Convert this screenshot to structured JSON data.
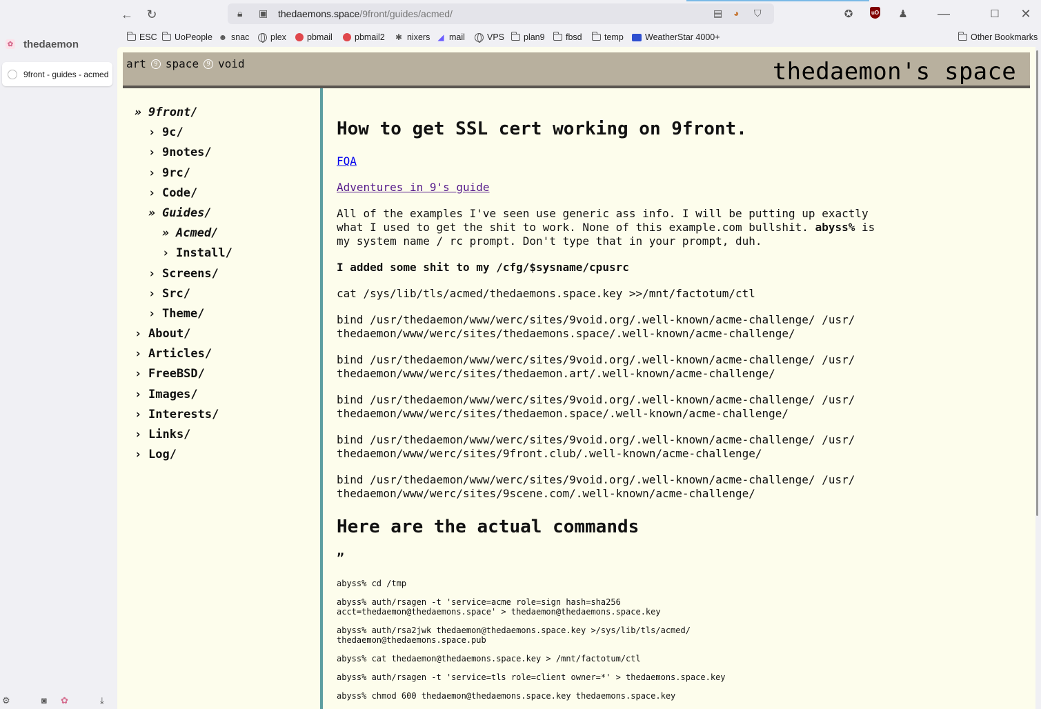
{
  "browser": {
    "profile_name": "thedaemon",
    "tab_title": "9front - guides - acmed",
    "url_host": "thedaemons.space",
    "url_path": "/9front/guides/acmed/",
    "bookmarks": [
      "ESC",
      "UoPeople",
      "snac",
      "plex",
      "pbmail",
      "pbmail2",
      "nixers",
      "mail",
      "VPS",
      "plan9",
      "fbsd",
      "temp",
      "WeatherStar 4000+"
    ],
    "other_bookmarks": "Other Bookmarks"
  },
  "site": {
    "title": "thedaemon's space",
    "topnav": [
      "art",
      "space",
      "void"
    ]
  },
  "nav": [
    {
      "label": "9front/",
      "open": true
    },
    {
      "label": "9c/"
    },
    {
      "label": "9notes/"
    },
    {
      "label": "9rc/"
    },
    {
      "label": "Code/"
    },
    {
      "label": "Guides/",
      "open": true
    },
    {
      "label": "Acmed/",
      "open": true
    },
    {
      "label": "Install/"
    },
    {
      "label": "Screens/"
    },
    {
      "label": "Src/"
    },
    {
      "label": "Theme/"
    },
    {
      "label": "About/"
    },
    {
      "label": "Articles/"
    },
    {
      "label": "FreeBSD/"
    },
    {
      "label": "Images/"
    },
    {
      "label": "Interests/"
    },
    {
      "label": "Links/"
    },
    {
      "label": "Log/"
    }
  ],
  "article": {
    "title": "How to get SSL cert working on 9front.",
    "link_fqa": "FQA",
    "link_adventures": "Adventures in 9's guide",
    "intro_1": "All of the examples I've seen use generic ass info. I will be putting up exactly what I used to get the shit to work. None of this example.com bullshit. ",
    "intro_bold": "abyss%",
    "intro_2": " is my system name / rc prompt. Don't type that in your prompt, duh.",
    "added_heading": "I added some shit to my /cfg/$sysname/cpusrc",
    "cpusrc_lines": [
      "cat /sys/lib/tls/acmed/thedaemons.space.key >>/mnt/factotum/ctl",
      "bind /usr/thedaemon/www/werc/sites/9void.org/.well-known/acme-challenge/ /usr/\nthedaemon/www/werc/sites/thedaemons.space/.well-known/acme-challenge/",
      "bind /usr/thedaemon/www/werc/sites/9void.org/.well-known/acme-challenge/ /usr/\nthedaemon/www/werc/sites/thedaemon.art/.well-known/acme-challenge/",
      "bind /usr/thedaemon/www/werc/sites/9void.org/.well-known/acme-challenge/ /usr/\nthedaemon/www/werc/sites/thedaemon.space/.well-known/acme-challenge/",
      "bind /usr/thedaemon/www/werc/sites/9void.org/.well-known/acme-challenge/ /usr/\nthedaemon/www/werc/sites/9front.club/.well-known/acme-challenge/",
      "bind /usr/thedaemon/www/werc/sites/9void.org/.well-known/acme-challenge/ /usr/\nthedaemon/www/werc/sites/9scene.com/.well-known/acme-challenge/"
    ],
    "commands_heading": "Here are the actual commands",
    "quote_mark": "”",
    "commands": [
      "abyss% cd /tmp",
      "abyss% auth/rsagen -t 'service=acme role=sign hash=sha256\nacct=thedaemon@thedaemons.space' > thedaemon@thedaemons.space.key",
      "abyss% auth/rsa2jwk thedaemon@thedaemons.space.key >/sys/lib/tls/acmed/\nthedaemon@thedaemons.space.pub",
      "abyss% cat thedaemon@thedaemons.space.key > /mnt/factotum/ctl",
      "abyss% auth/rsagen -t 'service=tls role=client owner=*' > thedaemons.space.key",
      "abyss% chmod 600 thedaemon@thedaemons.space.key thedaemons.space.key"
    ]
  }
}
